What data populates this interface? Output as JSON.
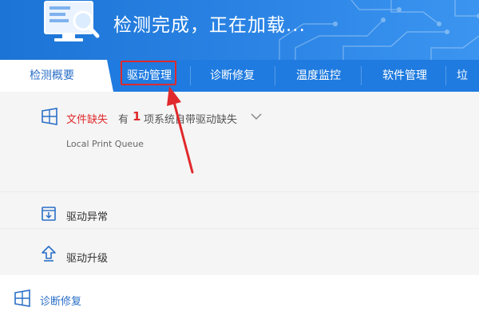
{
  "header": {
    "title": "检测完成，正在加载..."
  },
  "tabs": [
    {
      "label": "检测概要",
      "active": true
    },
    {
      "label": "驱动管理",
      "active": false,
      "highlighted": true
    },
    {
      "label": "诊断修复",
      "active": false
    },
    {
      "label": "温度监控",
      "active": false
    },
    {
      "label": "软件管理",
      "active": false
    },
    {
      "label": "垃",
      "active": false
    }
  ],
  "missing_files": {
    "label": "文件缺失",
    "prefix": "有",
    "count": "1",
    "suffix": "项系统自带驱动缺失",
    "item": "Local Print Queue"
  },
  "driver_abnormal": {
    "label": "驱动异常"
  },
  "driver_upgrade": {
    "label": "驱动升级"
  },
  "diagnose_repair": {
    "label": "诊断修复"
  },
  "colors": {
    "header_blue": "#2d86e6",
    "tab_blue": "#1f7be0",
    "warning_red": "#e0292c",
    "link_blue": "#2a6fc7"
  }
}
